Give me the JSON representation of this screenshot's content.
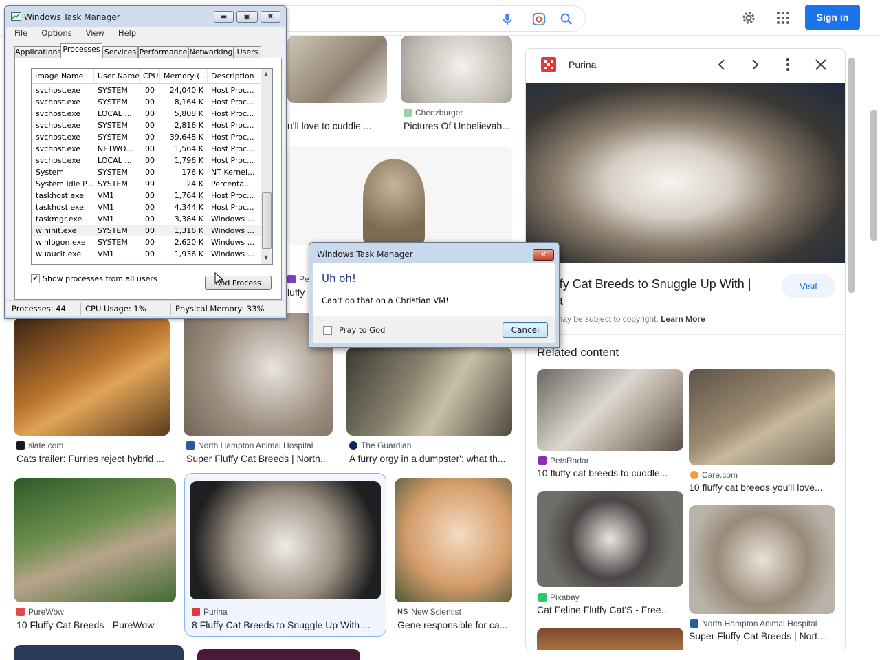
{
  "topbar": {
    "signin_label": "Sign in",
    "icons": [
      "mic-icon",
      "lens-icon",
      "search-icon",
      "settings-icon",
      "apps-icon"
    ]
  },
  "grid": {
    "row0": [
      {
        "title": "u'll love to cuddle ..."
      },
      {
        "source": "Cheezburger",
        "title": "Pictures Of Unbelievab..."
      }
    ],
    "row1": [
      {
        "source": "slate.com",
        "title": "Cats trailer: Furries reject hybrid ..."
      },
      {
        "source": "North Hampton Animal Hospital",
        "title": "Super Fluffy Cat Breeds | North..."
      },
      {
        "source": "The Guardian",
        "title": "A furry orgy in a dumpster': what th..."
      }
    ],
    "row2": [
      {
        "source": "PureWow",
        "title": "10 Fluffy Cat Breeds - PureWow"
      },
      {
        "source": "Purina",
        "title": "8 Fluffy Cat Breeds to Snuggle Up With ..."
      },
      {
        "source": "New Scientist",
        "title": "Gene responsible for ca..."
      }
    ],
    "partial": {
      "source_fragment": "Petf",
      "title_fragment": "luffy"
    }
  },
  "panel": {
    "source": "Purina",
    "title_line1": "uffy Cat Breeds to Snuggle Up With |",
    "title_line2": "na",
    "copyright": "s may be subject to copyright.",
    "learn_more": "Learn More",
    "visit_label": "Visit",
    "related_heading": "Related content",
    "related": [
      {
        "source": "PetsRadar",
        "title": "10 fluffy cat breeds to cuddle..."
      },
      {
        "source": "Care.com",
        "title": "10 fluffy cat breeds you'll love..."
      },
      {
        "source": "Pixabay",
        "title": "Cat Feline Fluffy Cat'S - Free..."
      },
      {
        "source": "North Hampton Animal Hospital",
        "title": "Super Fluffy Cat Breeds | Nort..."
      }
    ]
  },
  "taskmgr": {
    "title": "Windows Task Manager",
    "menu": [
      "File",
      "Options",
      "View",
      "Help"
    ],
    "tabs": [
      "Applications",
      "Processes",
      "Services",
      "Performance",
      "Networking",
      "Users"
    ],
    "active_tab": "Processes",
    "columns": [
      "Image Name",
      "User Name",
      "CPU",
      "Memory (...",
      "Description"
    ],
    "rows": [
      [
        "svchost.exe",
        "SYSTEM",
        "00",
        "24,040 K",
        "Host Proc..."
      ],
      [
        "svchost.exe",
        "SYSTEM",
        "00",
        "8,164 K",
        "Host Proc..."
      ],
      [
        "svchost.exe",
        "LOCAL ...",
        "00",
        "5,808 K",
        "Host Proc..."
      ],
      [
        "svchost.exe",
        "SYSTEM",
        "00",
        "2,816 K",
        "Host Proc..."
      ],
      [
        "svchost.exe",
        "SYSTEM",
        "00",
        "39,648 K",
        "Host Proc..."
      ],
      [
        "svchost.exe",
        "NETWO...",
        "00",
        "1,564 K",
        "Host Proc..."
      ],
      [
        "svchost.exe",
        "LOCAL ...",
        "00",
        "1,796 K",
        "Host Proc..."
      ],
      [
        "System",
        "SYSTEM",
        "00",
        "176 K",
        "NT Kernel..."
      ],
      [
        "System Idle P...",
        "SYSTEM",
        "99",
        "24 K",
        "Percenta..."
      ],
      [
        "taskhost.exe",
        "VM1",
        "00",
        "1,764 K",
        "Host Proc..."
      ],
      [
        "taskhost.exe",
        "VM1",
        "00",
        "4,344 K",
        "Host Proc..."
      ],
      [
        "taskmgr.exe",
        "VM1",
        "00",
        "3,384 K",
        "Windows ..."
      ],
      [
        "wininit.exe",
        "SYSTEM",
        "00",
        "1,316 K",
        "Windows ..."
      ],
      [
        "winlogon.exe",
        "SYSTEM",
        "00",
        "2,620 K",
        "Windows ..."
      ],
      [
        "wuauclt.exe",
        "VM1",
        "00",
        "1,936 K",
        "Windows ..."
      ]
    ],
    "selected_row": 12,
    "show_all_label": "Show processes from all users",
    "show_all_checked": true,
    "end_process_label": "End Process",
    "status": {
      "processes": "Processes: 44",
      "cpu": "CPU Usage: 1%",
      "memory": "Physical Memory: 33%"
    }
  },
  "dialog": {
    "title": "Windows Task Manager",
    "heading": "Uh oh!",
    "message": "Can't do that on a Christian VM!",
    "checkbox_label": "Pray to God",
    "checkbox_checked": false,
    "cancel_label": "Cancel"
  }
}
